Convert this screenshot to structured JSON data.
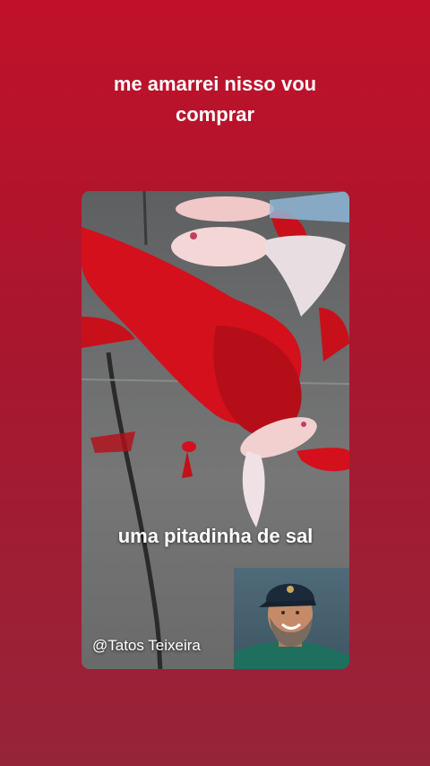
{
  "caption": {
    "line1": "me amarrei nisso vou",
    "line2": "comprar"
  },
  "video": {
    "overlay_text": "uma pitadinha de sal",
    "handle": "@Tatos Teixeira"
  },
  "colors": {
    "background_top": "#c0112a",
    "background_bottom": "#962439",
    "text": "#ffffff",
    "fish_red": "#d4101c"
  }
}
